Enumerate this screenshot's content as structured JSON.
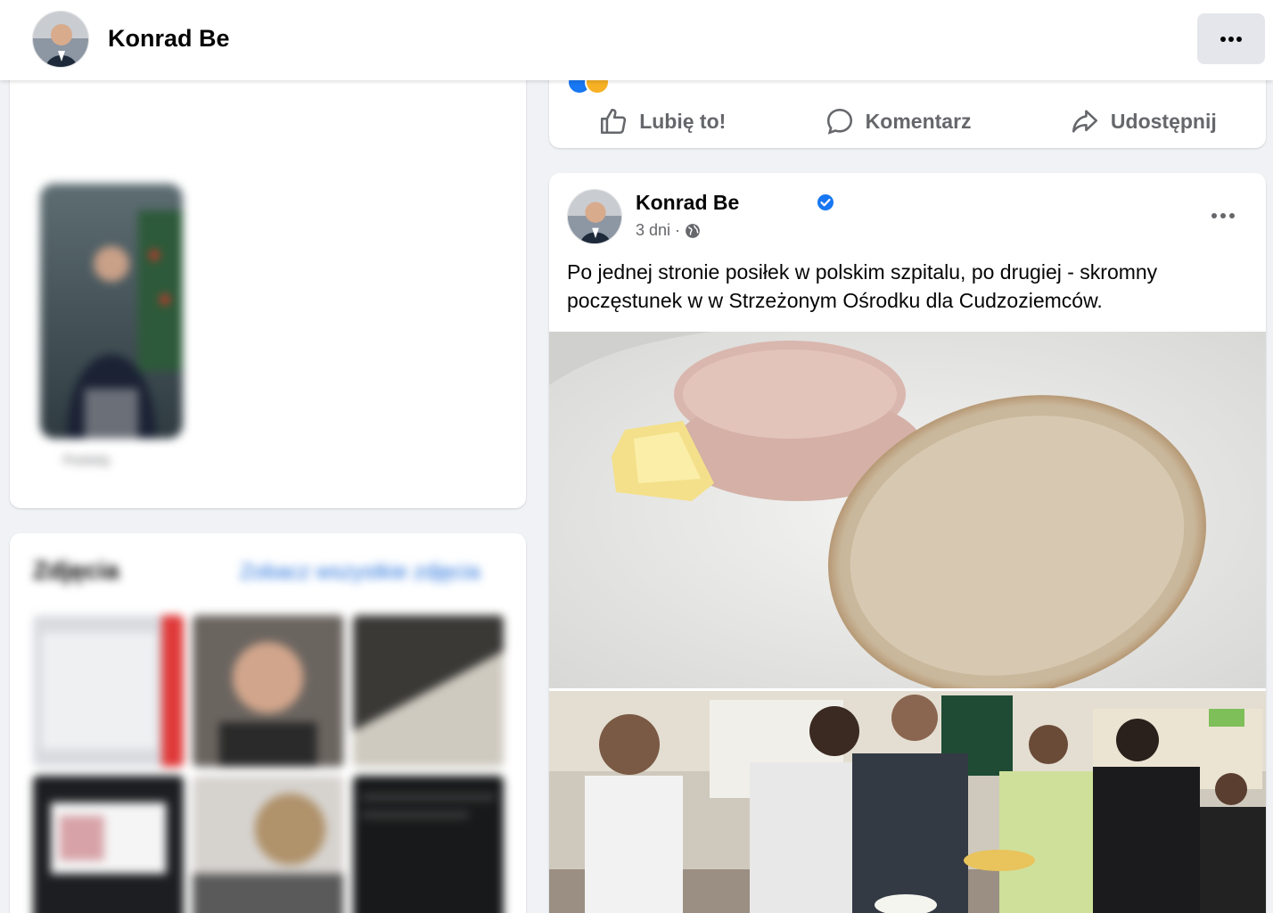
{
  "header": {
    "name": "Konrad Be",
    "more_icon": "more-horizontal-icon"
  },
  "left_intro": {
    "thumb_caption": "Portrety"
  },
  "photos_section": {
    "title": "Zdjęcia",
    "see_all": "Zobacz wszystkie zdjęcia"
  },
  "actions": {
    "like": "Lubię to!",
    "comment": "Komentarz",
    "share": "Udostępnij"
  },
  "post": {
    "author": "Konrad Be",
    "time": "3 dni",
    "separator": "·",
    "audience_icon": "globe-icon",
    "text": "Po jednej stronie posiłek w polskim szpitalu, po drugiej - skromny poczęstunek w w Strzeżonym Ośrodku dla Cudzoziemców."
  },
  "colors": {
    "accent": "#1877f2",
    "secondary_text": "#65676b",
    "background": "#f0f2f5"
  }
}
